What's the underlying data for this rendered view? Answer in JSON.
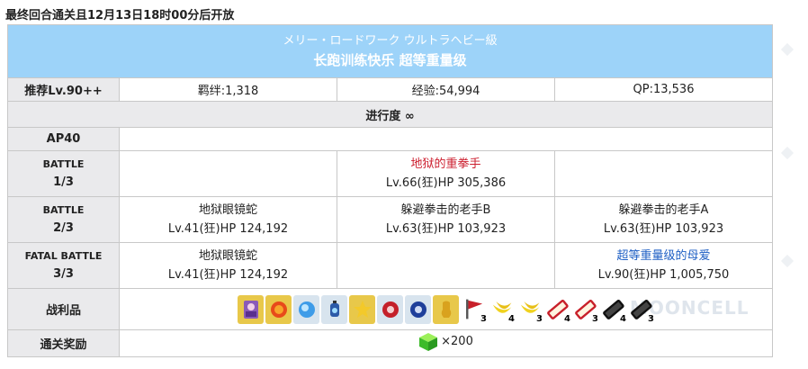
{
  "notice": "最终回合通关且12月13日18时00分后开放",
  "watermark": "MOONCELL",
  "title": {
    "sub": "メリー・ロードワーク ウルトラヘビー級",
    "main": "长跑训练快乐 超等重量级"
  },
  "stats": {
    "recommend": "推荐Lv.90++",
    "bond": "羁绊:1,318",
    "exp": "经验:54,994",
    "qp": "QP:13,536"
  },
  "progress": "进行度 ∞",
  "ap": "AP40",
  "battles": [
    {
      "label": "BATTLE",
      "num": "1/3",
      "enemies": [
        {
          "name": "",
          "stat": ""
        },
        {
          "name": "地狱的重拳手",
          "stat": "Lv.66(狂)HP 305,386",
          "color": "red"
        },
        {
          "name": "",
          "stat": ""
        }
      ]
    },
    {
      "label": "BATTLE",
      "num": "2/3",
      "enemies": [
        {
          "name": "地狱眼镜蛇",
          "stat": "Lv.41(狂)HP 124,192"
        },
        {
          "name": "躲避拳击的老手B",
          "stat": "Lv.63(狂)HP 103,923"
        },
        {
          "name": "躲避拳击的老手A",
          "stat": "Lv.63(狂)HP 103,923"
        }
      ]
    },
    {
      "label": "FATAL BATTLE",
      "num": "3/3",
      "enemies": [
        {
          "name": "地狱眼镜蛇",
          "stat": "Lv.41(狂)HP 124,192"
        },
        {
          "name": "",
          "stat": ""
        },
        {
          "name": "超等重量级的母爱",
          "stat": "Lv.90(狂)HP 1,005,750",
          "color": "blue"
        }
      ]
    }
  ],
  "drops_label": "战利品",
  "drops": [
    {
      "icon": "servant-card-icon",
      "bg": "#e8c84a"
    },
    {
      "icon": "craft-essence-flame-icon",
      "bg": "#e8c84a"
    },
    {
      "icon": "blue-orb-icon",
      "bg": "#d8e4ee"
    },
    {
      "icon": "lantern-icon",
      "bg": "#d8e4ee"
    },
    {
      "icon": "gold-star-icon",
      "bg": "#e8c84a"
    },
    {
      "icon": "red-crest-icon",
      "bg": "#d8e4ee"
    },
    {
      "icon": "blue-crest-icon",
      "bg": "#d8e4ee"
    },
    {
      "icon": "gold-figure-icon",
      "bg": "#e8c84a"
    },
    {
      "icon": "red-flag-icon",
      "count": "3"
    },
    {
      "icon": "banana-icon",
      "count": "4"
    },
    {
      "icon": "banana-icon",
      "count": "3"
    },
    {
      "icon": "red-ticket-icon",
      "count": "4"
    },
    {
      "icon": "red-ticket-icon",
      "count": "3"
    },
    {
      "icon": "black-ticket-icon",
      "count": "4"
    },
    {
      "icon": "black-ticket-icon",
      "count": "3"
    }
  ],
  "reward_label": "通关奖励",
  "reward": {
    "icon": "green-cube-icon",
    "amount": "×200"
  }
}
